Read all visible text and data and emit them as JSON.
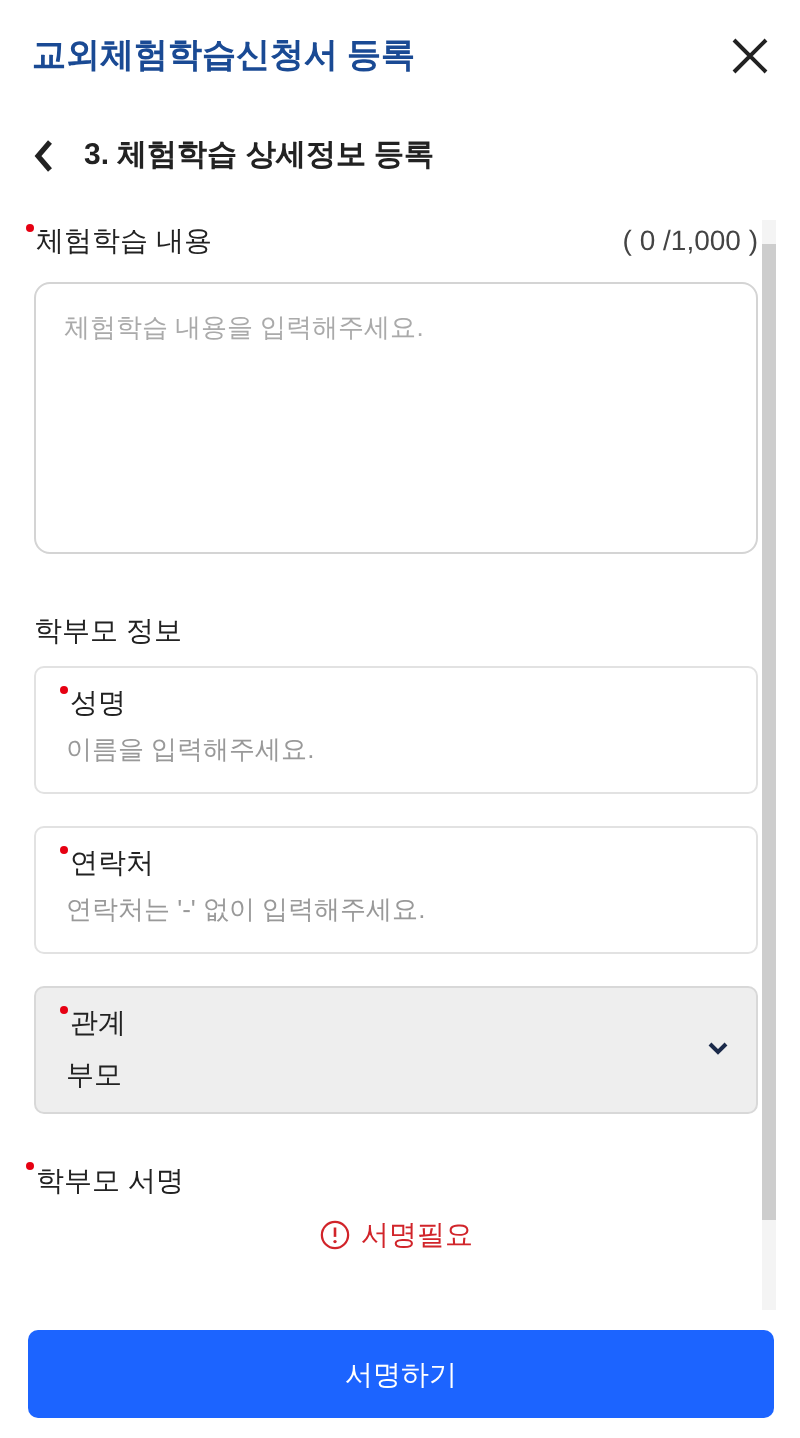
{
  "header": {
    "title": "교외체험학습신청서 등록"
  },
  "step": {
    "title": "3. 체험학습 상세정보 등록"
  },
  "content": {
    "label": "체험학습 내용",
    "required": true,
    "counter": "( 0 /1,000 )",
    "placeholder": "체험학습 내용을 입력해주세요."
  },
  "parent_section": {
    "title": "학부모 정보"
  },
  "fields": [
    {
      "kind": "text",
      "label": "성명",
      "required": true,
      "placeholder": "이름을 입력해주세요."
    },
    {
      "kind": "text",
      "label": "연락처",
      "required": true,
      "placeholder": "연락처는 '-' 없이 입력해주세요."
    },
    {
      "kind": "select",
      "label": "관계",
      "required": true,
      "value": "부모"
    }
  ],
  "signature": {
    "label": "학부모 서명",
    "required": true,
    "status": "서명필요"
  },
  "button": {
    "label": "서명하기"
  }
}
